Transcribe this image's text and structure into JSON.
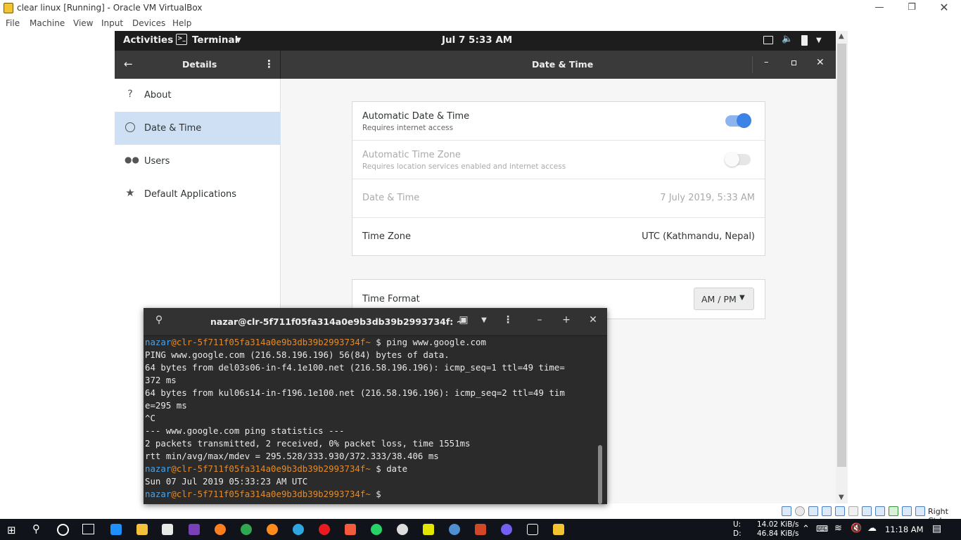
{
  "host": {
    "title": "clear linux [Running] - Oracle VM VirtualBox",
    "menu": [
      "File",
      "Machine",
      "View",
      "Input",
      "Devices",
      "Help"
    ],
    "status_right": "Right Ctrl"
  },
  "gnome": {
    "activities": "Activities",
    "app": "Terminal",
    "clock": "Jul 7   5:33 AM"
  },
  "settings": {
    "left_title": "Details",
    "title": "Date & Time",
    "sidebar": [
      {
        "label": "About",
        "icon": "question-icon"
      },
      {
        "label": "Date & Time",
        "icon": "clock-icon"
      },
      {
        "label": "Users",
        "icon": "users-icon"
      },
      {
        "label": "Default Applications",
        "icon": "star-icon"
      }
    ],
    "auto_dt": {
      "title": "Automatic Date & Time",
      "sub": "Requires internet access",
      "on": true
    },
    "auto_tz": {
      "title": "Automatic Time Zone",
      "sub": "Requires location services enabled and internet access",
      "on": false
    },
    "date_time": {
      "label": "Date & Time",
      "value": "7 July 2019,  5:33 AM"
    },
    "time_zone": {
      "label": "Time Zone",
      "value": "UTC (Kathmandu, Nepal)"
    },
    "time_format": {
      "label": "Time Format",
      "value": "AM / PM"
    }
  },
  "terminal": {
    "title": "nazar@clr-5f711f05fa314a0e9b3db39b2993734f: ~",
    "user": "nazar",
    "host": "@clr-5f711f05fa314a0e9b3db39b2993734f",
    "prompt_tail": "~ $ ",
    "cmd1": "ping www.google.com",
    "out1": [
      "PING www.google.com (216.58.196.196) 56(84) bytes of data.",
      "64 bytes from del03s06-in-f4.1e100.net (216.58.196.196): icmp_seq=1 ttl=49 time=",
      "372 ms",
      "64 bytes from kul06s14-in-f196.1e100.net (216.58.196.196): icmp_seq=2 ttl=49 tim",
      "e=295 ms",
      "^C",
      "--- www.google.com ping statistics ---",
      "2 packets transmitted, 2 received, 0% packet loss, time 1551ms",
      "rtt min/avg/max/mdev = 295.528/333.930/372.333/38.406 ms"
    ],
    "cmd2": "date",
    "out2": "Sun 07 Jul 2019 05:33:23 AM UTC"
  },
  "taskbar": {
    "net_up_label": "U:",
    "net_down_label": "D:",
    "net_up": "14.02 KiB/s",
    "net_down": "46.84 KiB/s",
    "time": "11:18 AM"
  }
}
